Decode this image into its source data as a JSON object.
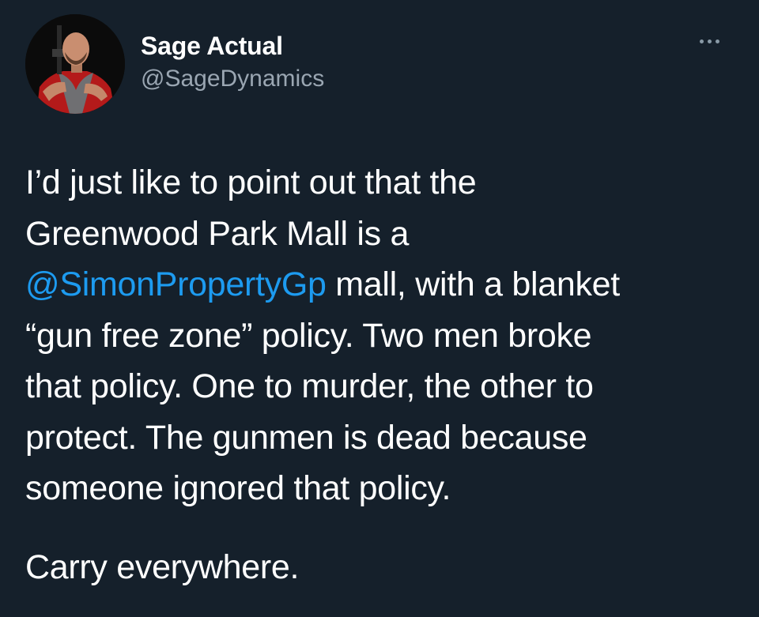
{
  "author": {
    "display_name": "Sage Actual",
    "handle": "@SageDynamics",
    "avatar_icon": "profile-photo"
  },
  "menu": {
    "icon": "more-horizontal-icon"
  },
  "tweet": {
    "lines": [
      {
        "text": "I’d just like to point out that the"
      },
      {
        "text": "Greenwood Park Mall is a"
      },
      {
        "mention": "@SimonPropertyGp",
        "text": " mall, with a blanket"
      },
      {
        "text": "“gun free zone” policy.  Two men broke"
      },
      {
        "text": "that policy. One to murder, the other to"
      },
      {
        "text": "protect. The gunmen is dead because"
      },
      {
        "text": "someone ignored that policy."
      }
    ],
    "closing": "Carry everywhere."
  },
  "colors": {
    "background": "#15202b",
    "text": "#ffffff",
    "secondary_text": "#9aa6b2",
    "link": "#1d9bf0"
  }
}
